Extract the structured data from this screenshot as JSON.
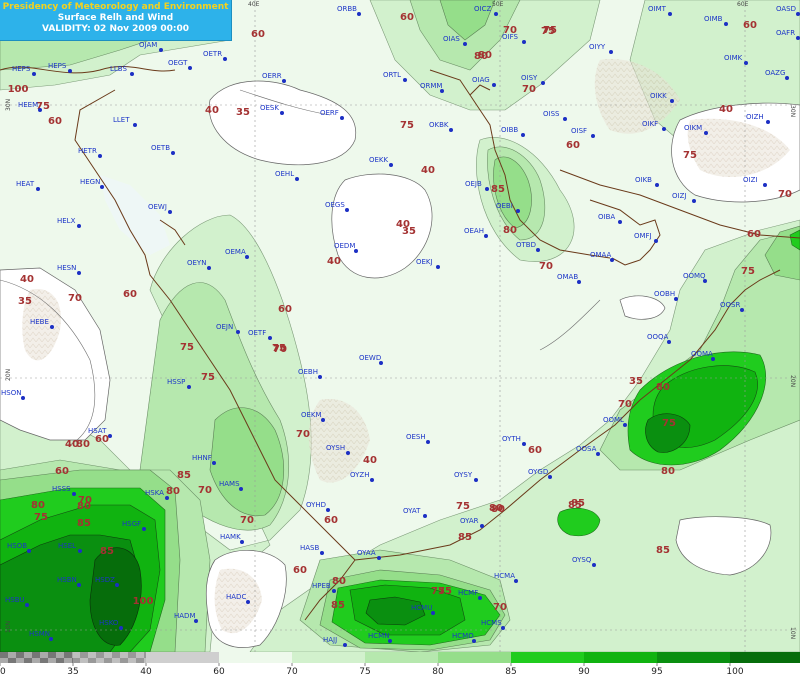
{
  "header": {
    "line1": "Presidency of Meteorology and Environment",
    "line2": "Surface Relh and Wind",
    "line3": "VALIDITY: 02 Nov 2009 00:00"
  },
  "colors": {
    "land": "#ffffff",
    "rh60": "#eef9ec",
    "rh70": "#d2f1cd",
    "rh75": "#b6e8ae",
    "rh80": "#95de8a",
    "rh85": "#20cc1e",
    "rh90": "#10b310",
    "rh95": "#0a8f10",
    "rh100": "#066d0b",
    "station": "#1c2fc4",
    "contour_label": "#a43232",
    "title_bg": "#2db2ea",
    "title_text": "#f4d21f"
  },
  "graticule": {
    "lon_labels": [
      "40E",
      "50E",
      "60E"
    ],
    "lat_labels": [
      "30N",
      "30N",
      "20N",
      "20N",
      "10N",
      "10N"
    ]
  },
  "legend": {
    "ticks": [
      "0",
      "35",
      "40",
      "60",
      "70",
      "75",
      "80",
      "85",
      "90",
      "95",
      "100"
    ]
  },
  "contour_labels": [
    "75",
    "70",
    "75",
    "60",
    "60",
    "40",
    "35",
    "60",
    "40",
    "35",
    "40",
    "60",
    "75",
    "60",
    "75",
    "80",
    "80",
    "70",
    "75",
    "60",
    "70",
    "75",
    "60",
    "70",
    "75",
    "60",
    "40",
    "40",
    "35",
    "60",
    "40",
    "35",
    "70",
    "75",
    "70",
    "60",
    "70",
    "75",
    "80",
    "85",
    "80",
    "75",
    "85",
    "85",
    "80",
    "75",
    "70",
    "75",
    "40",
    "60",
    "80",
    "80",
    "80",
    "70",
    "85",
    "85",
    "100",
    "100",
    "75",
    "70",
    "80",
    "85",
    "80",
    "60",
    "60",
    "85",
    "80",
    "75",
    "70",
    "80",
    "40",
    "70",
    "85",
    "85",
    "75"
  ],
  "stations": [
    "ORBB",
    "OICZ",
    "OIMT",
    "OIMB",
    "OASD",
    "OJAM",
    "OETR",
    "OEGT",
    "OIAS",
    "OIFS",
    "OIYY",
    "OIMK",
    "OAFR",
    "HEPS",
    "HEPS",
    "LLBS",
    "OERR",
    "ORTL",
    "OISY",
    "OAZG",
    "OIAG",
    "ORMM",
    "HEEM",
    "OESK",
    "OERF",
    "OISS",
    "OIKK",
    "LLET",
    "OKBK",
    "OIBB",
    "OISF",
    "OIKF",
    "OIKM",
    "OIZH",
    "HETR",
    "OETB",
    "OEKK",
    "OIZI",
    "HEAT",
    "HEGN",
    "OEHL",
    "OEJB",
    "OIKB",
    "OEGS",
    "OEBI",
    "OIZJ",
    "OEWJ",
    "OIBA",
    "HELX",
    "OEAH",
    "OTBD",
    "OMFJ",
    "OEMA",
    "OEDM",
    "OEKJ",
    "OMAA",
    "HESN",
    "OEYN",
    "OMAB",
    "OOMQ",
    "HEBE",
    "OOBH",
    "OOSR",
    "OEJN",
    "OETF",
    "OOQA",
    "OEWD",
    "OEBH",
    "OOMA",
    "HSSP",
    "HSON",
    "OEKM",
    "OOML",
    "OYSH",
    "HSAT",
    "OESH",
    "OYTH",
    "HHNF",
    "OOSA",
    "OYZH",
    "OYSY",
    "OYGD",
    "HAMS",
    "HSSS",
    "HSKA",
    "OYHD",
    "OYAT",
    "OYAR",
    "HSGF",
    "HAMK",
    "HSOB",
    "HSEL",
    "HASB",
    "OYAA",
    "HSDZ",
    "HSBN",
    "OYSQ",
    "HCMA",
    "HPEB",
    "HCMF",
    "HSBU",
    "HADC",
    "HCMU",
    "HADM",
    "HSKO",
    "HCMS",
    "HSMN",
    "HAJJ",
    "HCMN",
    "HCMO"
  ]
}
